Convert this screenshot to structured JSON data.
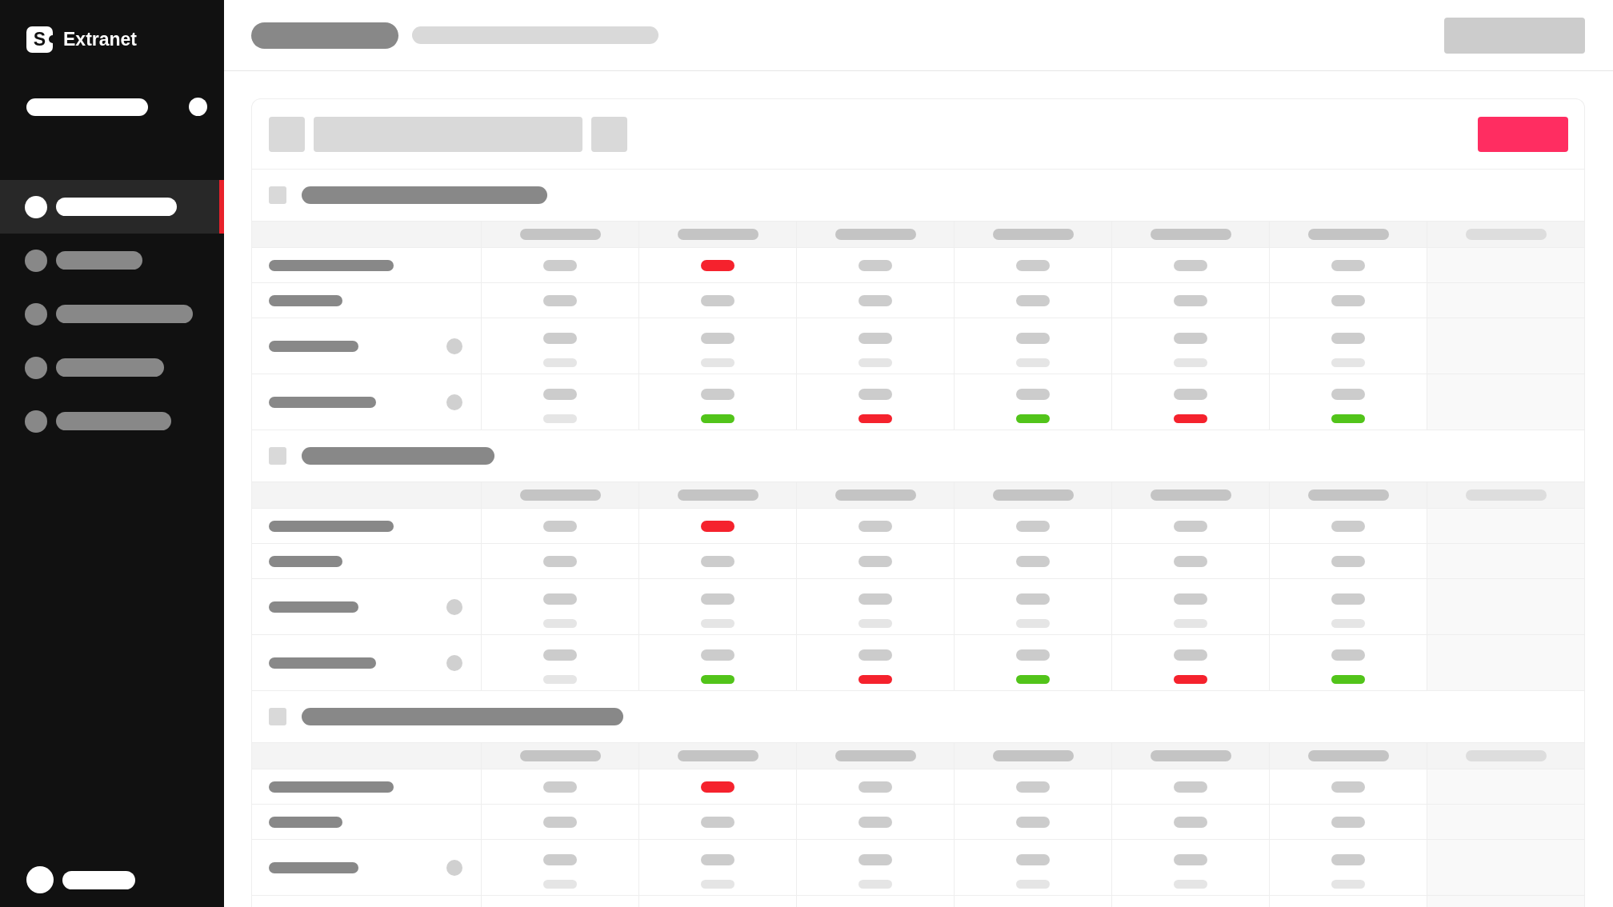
{
  "sidebar": {
    "logo": {
      "mark": "S",
      "name": "Extranet"
    },
    "items": [
      {
        "selected": true
      },
      {
        "selected": false
      },
      {
        "selected": false
      },
      {
        "selected": false
      },
      {
        "selected": false
      }
    ]
  },
  "sections": [
    {
      "checked": false,
      "columns": [
        {
          "disabled": false
        },
        {
          "disabled": false
        },
        {
          "disabled": false
        },
        {
          "disabled": false
        },
        {
          "disabled": false
        },
        {
          "disabled": false
        },
        {
          "disabled": true
        }
      ],
      "rows": [
        {
          "kind": "single",
          "cells": [
            {
              "color": "#cccccc"
            },
            {
              "color": "#f5222d"
            },
            {
              "color": "#cccccc"
            },
            {
              "color": "#cccccc"
            },
            {
              "color": "#cccccc"
            },
            {
              "color": "#cccccc"
            }
          ]
        },
        {
          "kind": "single",
          "cells": [
            {
              "color": "#cccccc"
            },
            {
              "color": "#cccccc"
            },
            {
              "color": "#cccccc"
            },
            {
              "color": "#cccccc"
            },
            {
              "color": "#cccccc"
            },
            {
              "color": "#cccccc"
            }
          ]
        },
        {
          "kind": "double",
          "cells": [
            {
              "color": "#e5e5e5"
            },
            {
              "color": "#e5e5e5"
            },
            {
              "color": "#e5e5e5"
            },
            {
              "color": "#e5e5e5"
            },
            {
              "color": "#e5e5e5"
            },
            {
              "color": "#e5e5e5"
            }
          ]
        },
        {
          "kind": "double",
          "cells": [
            {
              "color": "#e5e5e5"
            },
            {
              "color": "#52c41a"
            },
            {
              "color": "#f5222d"
            },
            {
              "color": "#52c41a"
            },
            {
              "color": "#f5222d"
            },
            {
              "color": "#52c41a"
            }
          ]
        }
      ]
    },
    {
      "checked": false,
      "columns": [
        {
          "disabled": false
        },
        {
          "disabled": false
        },
        {
          "disabled": false
        },
        {
          "disabled": false
        },
        {
          "disabled": false
        },
        {
          "disabled": false
        },
        {
          "disabled": true
        }
      ],
      "rows": [
        {
          "kind": "single",
          "cells": [
            {
              "color": "#cccccc"
            },
            {
              "color": "#f5222d"
            },
            {
              "color": "#cccccc"
            },
            {
              "color": "#cccccc"
            },
            {
              "color": "#cccccc"
            },
            {
              "color": "#cccccc"
            }
          ]
        },
        {
          "kind": "single",
          "cells": [
            {
              "color": "#cccccc"
            },
            {
              "color": "#cccccc"
            },
            {
              "color": "#cccccc"
            },
            {
              "color": "#cccccc"
            },
            {
              "color": "#cccccc"
            },
            {
              "color": "#cccccc"
            }
          ]
        },
        {
          "kind": "double",
          "cells": [
            {
              "color": "#e5e5e5"
            },
            {
              "color": "#e5e5e5"
            },
            {
              "color": "#e5e5e5"
            },
            {
              "color": "#e5e5e5"
            },
            {
              "color": "#e5e5e5"
            },
            {
              "color": "#e5e5e5"
            }
          ]
        },
        {
          "kind": "double",
          "cells": [
            {
              "color": "#e5e5e5"
            },
            {
              "color": "#52c41a"
            },
            {
              "color": "#f5222d"
            },
            {
              "color": "#52c41a"
            },
            {
              "color": "#f5222d"
            },
            {
              "color": "#52c41a"
            }
          ]
        }
      ]
    },
    {
      "checked": false,
      "columns": [
        {
          "disabled": false
        },
        {
          "disabled": false
        },
        {
          "disabled": false
        },
        {
          "disabled": false
        },
        {
          "disabled": false
        },
        {
          "disabled": false
        },
        {
          "disabled": true
        }
      ],
      "rows": [
        {
          "kind": "single",
          "cells": [
            {
              "color": "#cccccc"
            },
            {
              "color": "#f5222d"
            },
            {
              "color": "#cccccc"
            },
            {
              "color": "#cccccc"
            },
            {
              "color": "#cccccc"
            },
            {
              "color": "#cccccc"
            }
          ]
        },
        {
          "kind": "single",
          "cells": [
            {
              "color": "#cccccc"
            },
            {
              "color": "#cccccc"
            },
            {
              "color": "#cccccc"
            },
            {
              "color": "#cccccc"
            },
            {
              "color": "#cccccc"
            },
            {
              "color": "#cccccc"
            }
          ]
        },
        {
          "kind": "double",
          "cells": [
            {
              "color": "#e5e5e5"
            },
            {
              "color": "#e5e5e5"
            },
            {
              "color": "#e5e5e5"
            },
            {
              "color": "#e5e5e5"
            },
            {
              "color": "#e5e5e5"
            },
            {
              "color": "#e5e5e5"
            }
          ]
        }
      ]
    }
  ]
}
